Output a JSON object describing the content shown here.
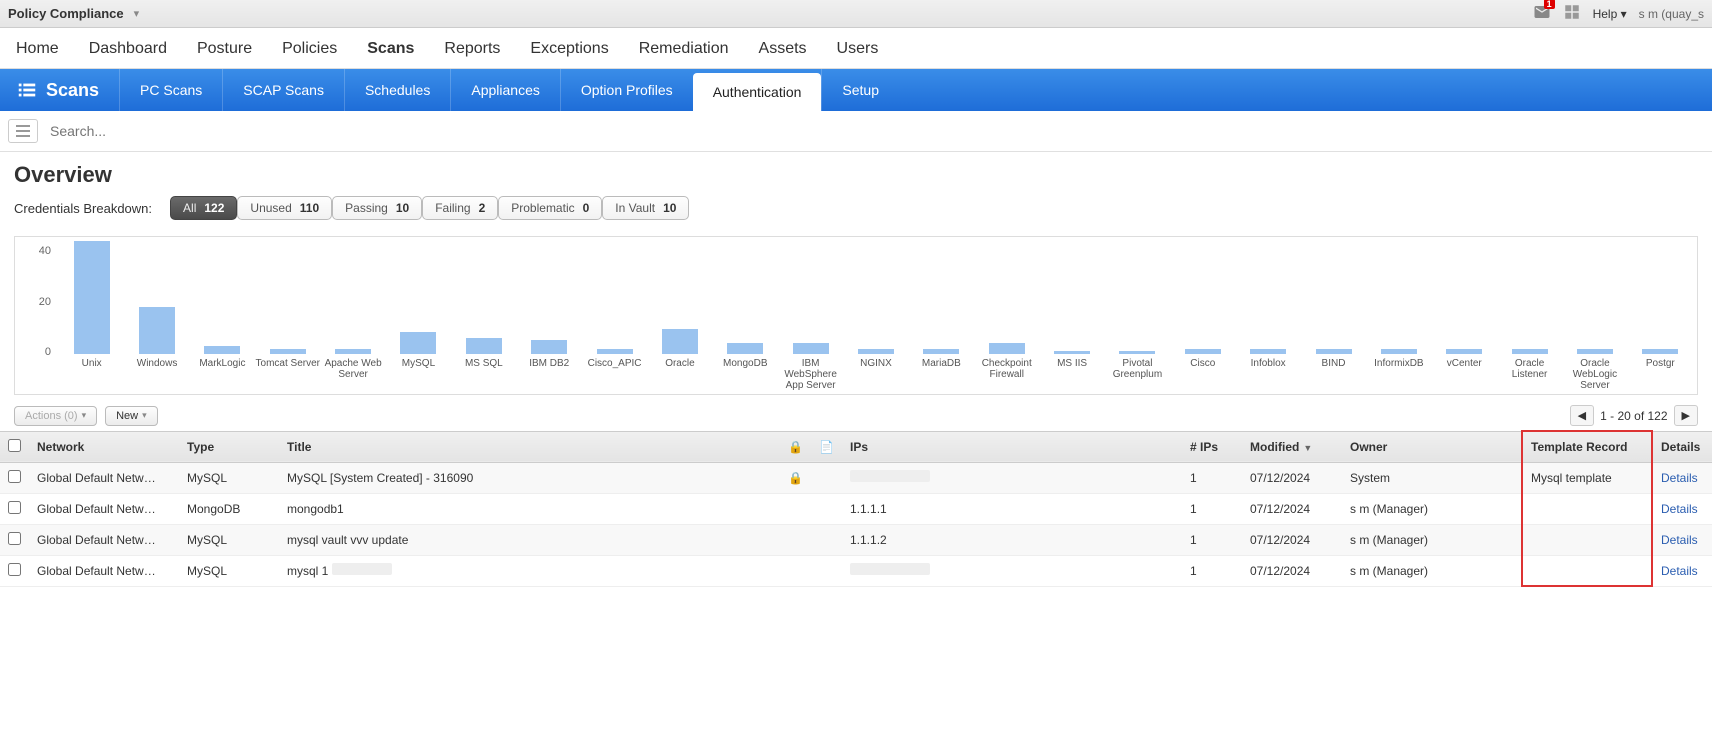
{
  "topBar": {
    "module": "Policy Compliance",
    "notifCount": "1",
    "help": "Help",
    "user": "s m (quay_s"
  },
  "mainNav": [
    "Home",
    "Dashboard",
    "Posture",
    "Policies",
    "Scans",
    "Reports",
    "Exceptions",
    "Remediation",
    "Assets",
    "Users"
  ],
  "mainNavActive": "Scans",
  "subNav": {
    "title": "Scans",
    "tabs": [
      "PC Scans",
      "SCAP Scans",
      "Schedules",
      "Appliances",
      "Option Profiles",
      "Authentication",
      "Setup"
    ],
    "active": "Authentication"
  },
  "search": {
    "placeholder": "Search..."
  },
  "overview": {
    "title": "Overview",
    "label": "Credentials Breakdown:",
    "pills": [
      {
        "lbl": "All",
        "val": "122",
        "dark": true
      },
      {
        "lbl": "Unused",
        "val": "110"
      },
      {
        "lbl": "Passing",
        "val": "10"
      },
      {
        "lbl": "Failing",
        "val": "2"
      },
      {
        "lbl": "Problematic",
        "val": "0"
      },
      {
        "lbl": "In Vault",
        "val": "10"
      }
    ]
  },
  "chart_data": {
    "type": "bar",
    "ylim": [
      0,
      40
    ],
    "yticks": [
      0,
      20,
      40
    ],
    "categories": [
      "Unix",
      "Windows",
      "MarkLogic",
      "Tomcat Server",
      "Apache Web Server",
      "MySQL",
      "MS SQL",
      "IBM DB2",
      "Cisco_APIC",
      "Oracle",
      "MongoDB",
      "IBM WebSphere App Server",
      "NGINX",
      "MariaDB",
      "Checkpoint Firewall",
      "MS IIS",
      "Pivotal Greenplum",
      "Cisco",
      "Infoblox",
      "BIND",
      "InformixDB",
      "vCenter",
      "Oracle Listener",
      "Oracle WebLogic Server",
      "Postgr"
    ],
    "values": [
      41,
      17,
      3,
      2,
      2,
      8,
      6,
      5,
      2,
      9,
      4,
      4,
      2,
      2,
      4,
      1,
      1,
      2,
      2,
      2,
      2,
      2,
      2,
      2,
      2
    ]
  },
  "actionRow": {
    "actions": "Actions (0)",
    "new": "New",
    "pager": "1 - 20 of 122"
  },
  "table": {
    "headers": [
      "",
      "Network",
      "Type",
      "Title",
      "",
      "",
      "IPs",
      "# IPs",
      "Modified",
      "Owner",
      "Template Record",
      "Details"
    ],
    "sortCol": "Modified",
    "rows": [
      {
        "network": "Global Default Netw…",
        "type": "MySQL",
        "title": "MySQL [System Created] - 316090",
        "lock": true,
        "ips": "",
        "numips": "1",
        "modified": "07/12/2024",
        "owner": "System",
        "template": "Mysql template",
        "details": "Details",
        "ipsRedacted": true
      },
      {
        "network": "Global Default Netw…",
        "type": "MongoDB",
        "title": "mongodb1",
        "lock": false,
        "ips": "1.1.1.1",
        "numips": "1",
        "modified": "07/12/2024",
        "owner": "s m (Manager)",
        "template": "",
        "details": "Details"
      },
      {
        "network": "Global Default Netw…",
        "type": "MySQL",
        "title": "mysql vault vvv update",
        "lock": false,
        "ips": "1.1.1.2",
        "numips": "1",
        "modified": "07/12/2024",
        "owner": "s m (Manager)",
        "template": "",
        "details": "Details"
      },
      {
        "network": "Global Default Netw…",
        "type": "MySQL",
        "title": "mysql 1",
        "lock": false,
        "ips": "",
        "numips": "1",
        "modified": "07/12/2024",
        "owner": "s m (Manager)",
        "template": "",
        "details": "Details",
        "titleRedacted": true,
        "ipsRedacted": true
      }
    ]
  }
}
